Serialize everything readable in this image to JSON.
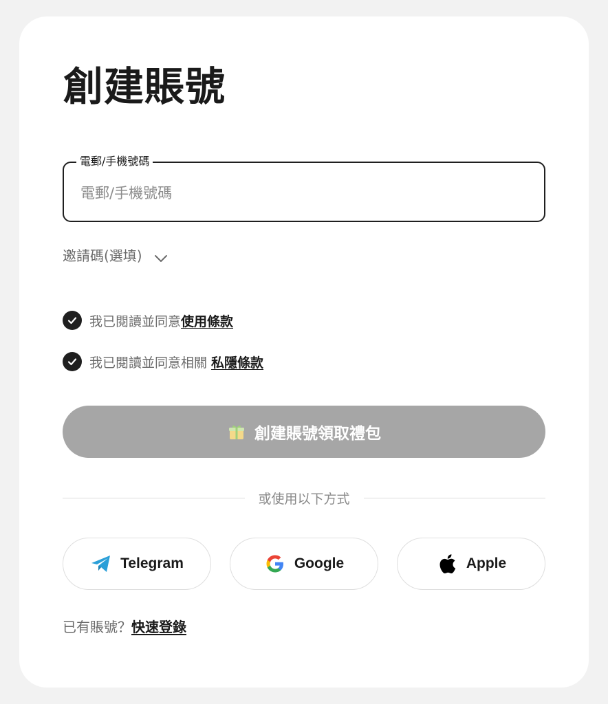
{
  "page": {
    "title": "創建賬號"
  },
  "account_field": {
    "label": "電郵/手機號碼",
    "placeholder": "電郵/手機號碼",
    "value": ""
  },
  "invite_code": {
    "label": "邀請碼(選填)",
    "icon": "chevron-down-icon"
  },
  "agreements": [
    {
      "text": "我已閱讀並同意",
      "link": "使用條款",
      "checked": true,
      "icon": "check-circle-icon"
    },
    {
      "text": "我已閱讀並同意相關 ",
      "link": "私隱條款",
      "checked": true,
      "icon": "check-circle-icon"
    }
  ],
  "submit": {
    "label": "創建賬號領取禮包",
    "icon": "gift-icon",
    "color": "#a6a6a6"
  },
  "divider": {
    "label": "或使用以下方式"
  },
  "social_logins": [
    {
      "label": "Telegram",
      "icon": "telegram-icon",
      "color": "#2a9fd8"
    },
    {
      "label": "Google",
      "icon": "google-icon"
    },
    {
      "label": "Apple",
      "icon": "apple-icon",
      "color": "#000000"
    }
  ],
  "footer": {
    "text": "已有賬號？",
    "link": "快速登錄"
  }
}
